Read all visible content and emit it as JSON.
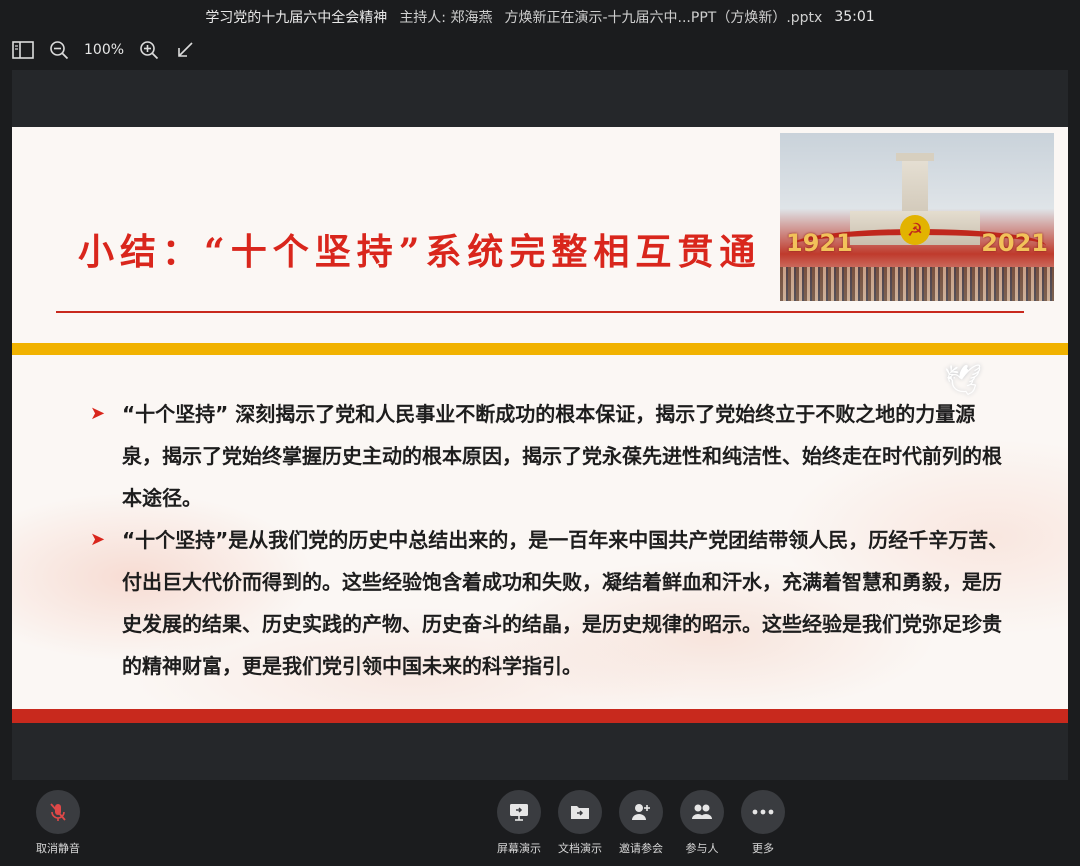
{
  "window": {
    "meeting_title": "学习党的十九届六中全会精神",
    "host": "主持人: 郑海燕",
    "presenting": "方焕新正在演示-十九届六中...PPT（方焕新）.pptx",
    "timer": "35:01"
  },
  "viewbar": {
    "zoom": "100%"
  },
  "slide": {
    "title": "小结：“十个坚持”系统完整相互贯通",
    "photo_year_left": "1921",
    "photo_year_right": "2021",
    "bullets": [
      "“十个坚持” 深刻揭示了党和人民事业不断成功的根本保证，揭示了党始终立于不败之地的力量源泉，揭示了党始终掌握历史主动的根本原因，揭示了党永葆先进性和纯洁性、始终走在时代前列的根本途径。",
      "“十个坚持”是从我们党的历史中总结出来的，是一百年来中国共产党团结带领人民，历经千辛万苦、付出巨大代价而得到的。这些经验饱含着成功和失败，凝结着鲜血和汗水，充满着智慧和勇毅，是历史发展的结果、历史实践的产物、历史奋斗的结晶，是历史规律的昭示。这些经验是我们党弥足珍贵的精神财富，更是我们党引领中国未来的科学指引。"
    ]
  },
  "controls": {
    "unmute": "取消静音",
    "screen_share": "屏幕演示",
    "doc_share": "文档演示",
    "invite": "邀请参会",
    "participants": "参与人",
    "more": "更多"
  },
  "colors": {
    "title_red": "#d9261c",
    "gold_band": "#f1b200",
    "red_band": "#c8291d",
    "mute_red": "#e04848"
  }
}
